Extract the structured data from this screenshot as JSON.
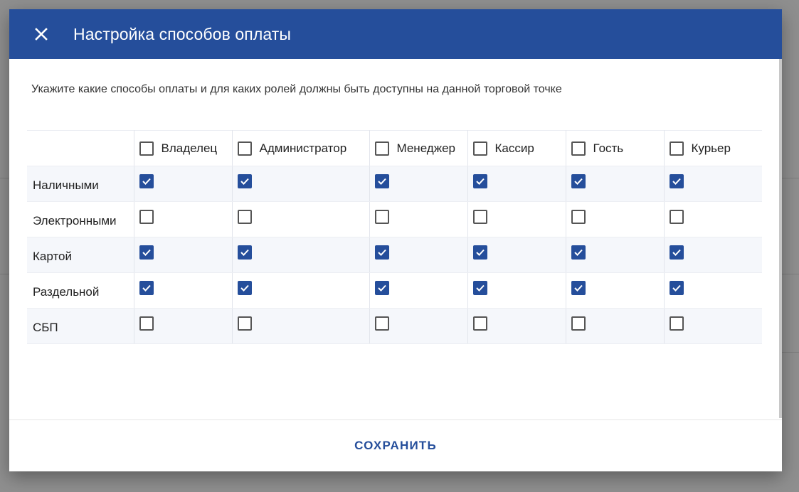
{
  "dialog": {
    "title": "Настройка способов оплаты",
    "description": "Укажите какие способы оплаты и для каких ролей должны быть доступны на данной торговой точке",
    "save_label": "СОХРАНИТЬ",
    "close_icon": "close-icon",
    "accent_color": "#254e9b"
  },
  "roles": [
    {
      "label": "Владелец",
      "checked": false
    },
    {
      "label": "Администратор",
      "checked": false
    },
    {
      "label": "Менеджер",
      "checked": false
    },
    {
      "label": "Кассир",
      "checked": false
    },
    {
      "label": "Гость",
      "checked": false
    },
    {
      "label": "Курьер",
      "checked": false
    }
  ],
  "methods": [
    {
      "label": "Наличными",
      "checked": [
        true,
        true,
        true,
        true,
        true,
        true
      ]
    },
    {
      "label": "Электронными",
      "checked": [
        false,
        false,
        false,
        false,
        false,
        false
      ]
    },
    {
      "label": "Картой",
      "checked": [
        true,
        true,
        true,
        true,
        true,
        true
      ]
    },
    {
      "label": "Раздельной",
      "checked": [
        true,
        true,
        true,
        true,
        true,
        true
      ]
    },
    {
      "label": "СБП",
      "checked": [
        false,
        false,
        false,
        false,
        false,
        false
      ]
    }
  ]
}
